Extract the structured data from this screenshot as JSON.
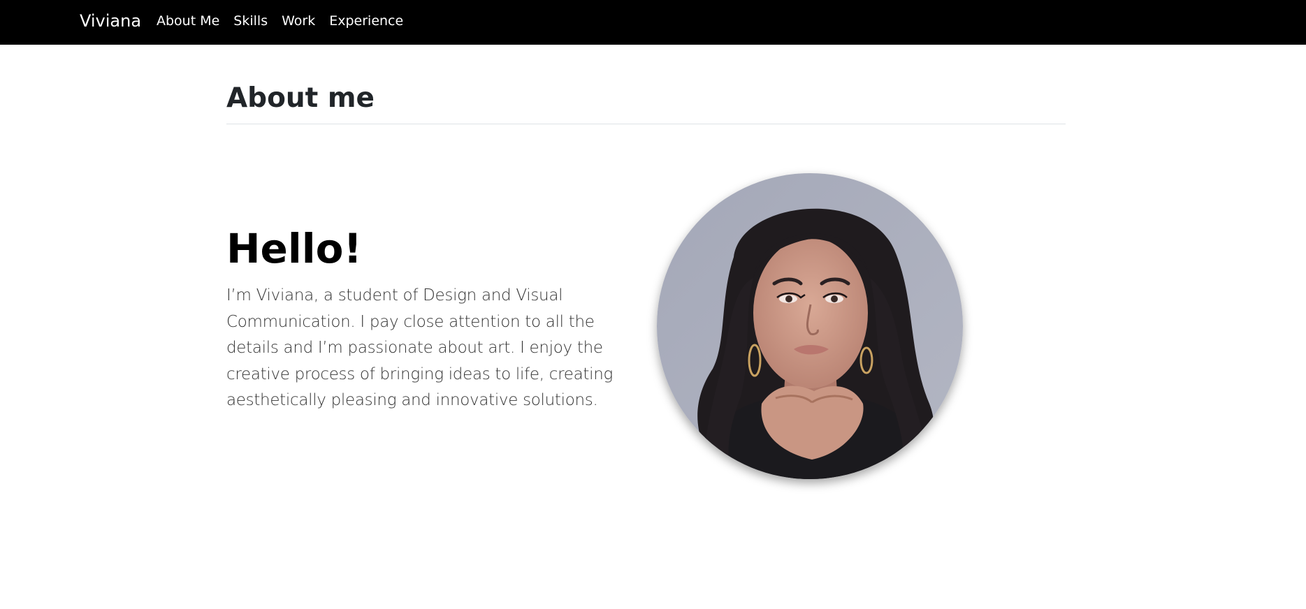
{
  "navbar": {
    "brand": "Viviana",
    "links": [
      {
        "label": "About Me"
      },
      {
        "label": "Skills"
      },
      {
        "label": "Work"
      },
      {
        "label": "Experience"
      }
    ]
  },
  "about": {
    "title": "About me",
    "greeting": "Hello!",
    "intro": "I’m Viviana, a student of Design and Visual Communication. I pay close attention to all the details and I’m passionate about art. I enjoy the creative process of bringing ideas to life, creating aesthetically pleasing and innovative solutions.",
    "photo": {
      "icon": "profile-photo",
      "background_color": "#a9acba"
    }
  },
  "colors": {
    "navbar_bg": "#000000",
    "nav_text": "#ffffff",
    "heading": "#212529",
    "body_text": "#333333"
  }
}
